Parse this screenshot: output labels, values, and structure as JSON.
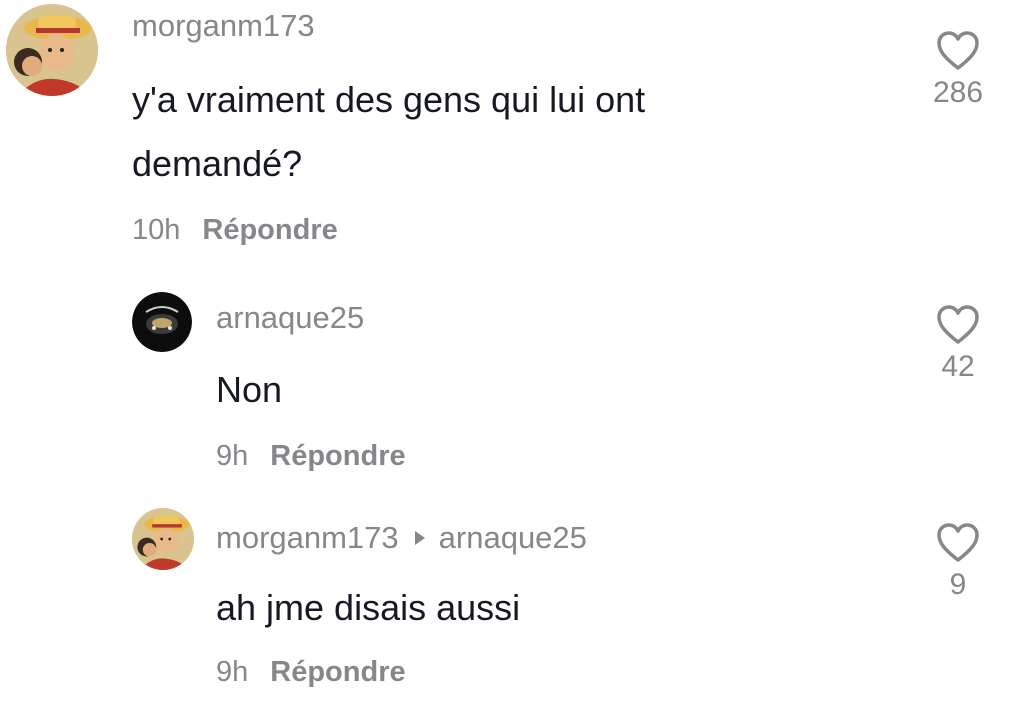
{
  "comments": [
    {
      "username": "morganm173",
      "text": "y'a vraiment des gens qui lui ont demandé?",
      "time": "10h",
      "reply_label": "Répondre",
      "likes": "286"
    },
    {
      "username": "arnaque25",
      "text": "Non",
      "time": "9h",
      "reply_label": "Répondre",
      "likes": "42"
    },
    {
      "username": "morganm173",
      "reply_to": "arnaque25",
      "text": "ah jme disais aussi",
      "time": "9h",
      "reply_label": "Répondre",
      "likes": "9"
    }
  ],
  "icons": {
    "like": "heart-outline-icon",
    "reply_arrow": "triangle-right-icon"
  },
  "colors": {
    "secondary_text": "#86878b",
    "primary_text": "#161823"
  }
}
